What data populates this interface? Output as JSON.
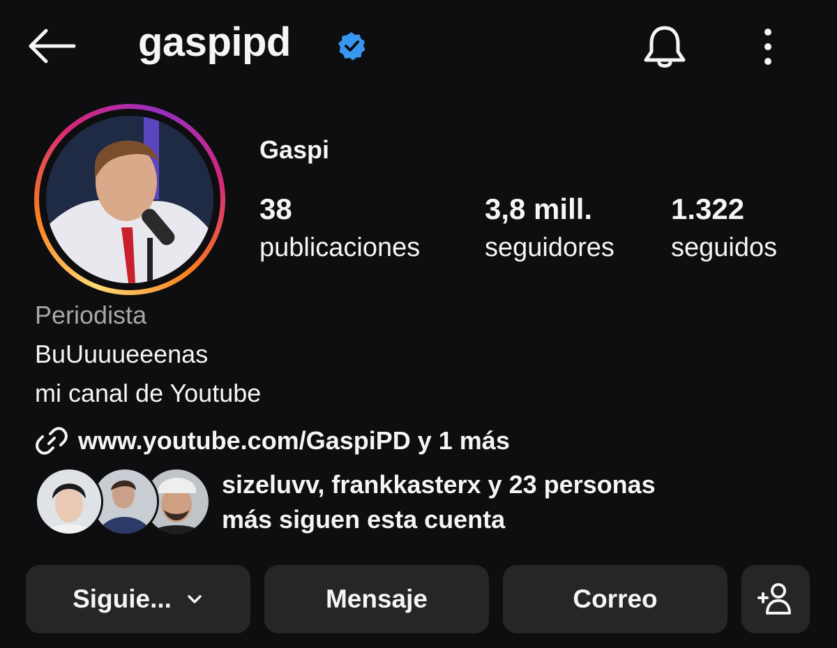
{
  "header": {
    "username": "gaspipd",
    "verified": true,
    "icons": [
      "back-arrow-icon",
      "verified-badge-icon",
      "bell-icon",
      "more-vertical-icon"
    ]
  },
  "profile": {
    "display_name": "Gaspi",
    "stats": [
      {
        "value": "38",
        "label": "publicaciones"
      },
      {
        "value": "3,8 mill.",
        "label": "seguidores"
      },
      {
        "value": "1.322",
        "label": "seguidos"
      }
    ],
    "category": "Periodista",
    "bio_lines": [
      "BuUuuueeenas",
      "mi canal de Youtube"
    ],
    "link": {
      "text": "www.youtube.com/GaspiPD y 1 más",
      "icon": "link-icon"
    },
    "mutual": {
      "text_line1": "sizeluvv, frankkasterx y 23 personas",
      "text_line2": "más siguen esta cuenta"
    }
  },
  "actions": {
    "follow_label": "Siguie...",
    "message_label": "Mensaje",
    "email_label": "Correo",
    "add_user_icon": "add-person-icon"
  },
  "colors": {
    "background": "#0e0e10",
    "button_bg": "#262628",
    "text": "#f5f5f5",
    "muted_text": "#a8a8a8",
    "verified": "#3797f0"
  }
}
